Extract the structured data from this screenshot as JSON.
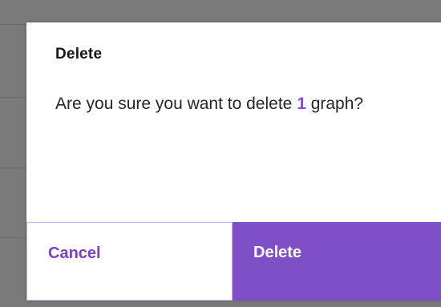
{
  "dialog": {
    "title": "Delete",
    "message_prefix": "Are you sure you want to delete ",
    "count": "1",
    "message_suffix": " graph?",
    "cancel_label": "Cancel",
    "delete_label": "Delete"
  },
  "colors": {
    "accent": "#7f4fc8",
    "count_highlight": "#8a3ffc",
    "backdrop": "#7a7a7a"
  }
}
